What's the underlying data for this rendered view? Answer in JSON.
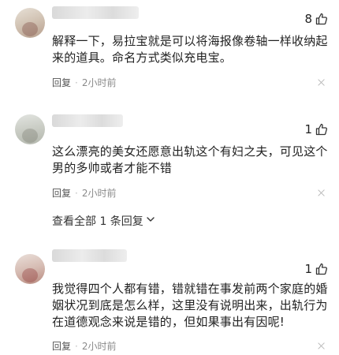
{
  "comments": [
    {
      "likes": "8",
      "text_line1": "解释一下，易拉宝就是可以将海报像卷轴一样收纳起",
      "text_line2": "来的道具。命名方式类似充电宝。",
      "reply_label": "回复",
      "time": "2小时前"
    },
    {
      "likes": "1",
      "text_line1": "这么漂亮的美女还愿意出轨这个有妇之夫，可见这个",
      "text_line2": "男的多帅或者才能不错",
      "reply_label": "回复",
      "time": "2小时前"
    },
    {
      "likes": "1",
      "text_line1": "我觉得四个人都有错，错就错在事发前两个家庭的婚",
      "text_line2": "姻状况到底是怎么样，这里没有说明出来，出轨行为",
      "text_line3": "在道德观念来说是错的，但如果事出有因呢!",
      "reply_label": "回复",
      "time": "2小时前"
    }
  ],
  "view_all_replies": "查看全部 1 条回复",
  "icons": {
    "like": "thumbs-up-icon",
    "close": "close-icon",
    "expand": "chevron-down-icon"
  },
  "colors": {
    "text": "#222222",
    "meta": "#8a8a8a"
  }
}
